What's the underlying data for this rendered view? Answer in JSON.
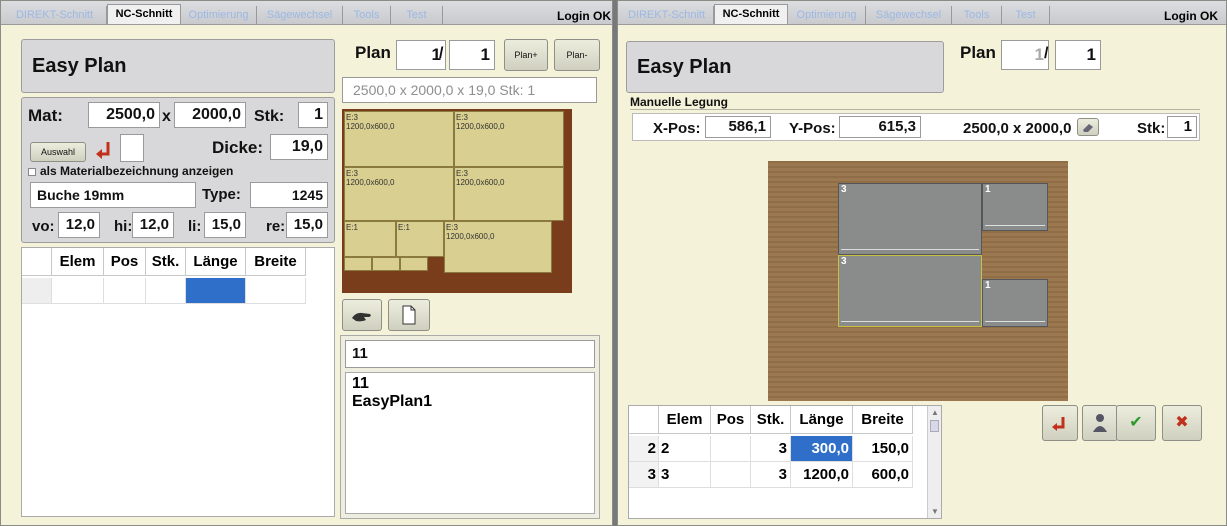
{
  "tabs": [
    "DIREKT-Schnitt",
    "NC-Schnitt",
    "Optimierung",
    "Sägewechsel",
    "Tools",
    "Test"
  ],
  "login": "Login OK",
  "left": {
    "title": "Easy Plan",
    "plan_label": "Plan",
    "plan_current": "1",
    "plan_sep": "/",
    "plan_total": "1",
    "plan_plus": "Plan+",
    "plan_minus": "Plan-",
    "plan_summary": "2500,0 x 2000,0 x 19,0 Stk: 1",
    "mat_label": "Mat:",
    "mat_w": "2500,0",
    "x_label": "x",
    "mat_h": "2000,0",
    "stk_label": "Stk:",
    "stk": "1",
    "auswahl": "Auswahl",
    "dicke_label": "Dicke:",
    "dicke": "19,0",
    "show_matname_label": "als Materialbezeichnung anzeigen",
    "material": "Buche 19mm",
    "type_label": "Type:",
    "type": "1245",
    "vo_label": "vo:",
    "vo": "12,0",
    "hi_label": "hi:",
    "hi": "12,0",
    "li_label": "li:",
    "li": "15,0",
    "re_label": "re:",
    "re": "15,0",
    "columns": [
      "Elem",
      "Pos",
      "Stk.",
      "Länge",
      "Breite"
    ],
    "pieces": [
      {
        "l1": "E:3",
        "l2": "1200,0x600,0"
      },
      {
        "l1": "E:3",
        "l2": "1200,0x600,0"
      },
      {
        "l1": "E:3",
        "l2": "1200,0x600,0"
      },
      {
        "l1": "E:3",
        "l2": "1200,0x600,0"
      },
      {
        "l1": "E:1",
        "l2": ""
      },
      {
        "l1": "E:1",
        "l2": ""
      },
      {
        "l1": "E:3",
        "l2": "1200,0x600,0"
      }
    ],
    "file_input": "11",
    "file_list": [
      "11",
      "EasyPlan1"
    ]
  },
  "right": {
    "title": "Easy Plan",
    "plan_label": "Plan",
    "plan_current": "1",
    "plan_sep": "/",
    "plan_total": "1",
    "section": "Manuelle Legung",
    "xpos_label": "X-Pos:",
    "xpos": "586,1",
    "ypos_label": "Y-Pos:",
    "ypos": "615,3",
    "dims": "2500,0 x 2000,0",
    "stk_label": "Stk:",
    "stk": "1",
    "piece_labels": [
      "3",
      "1",
      "3",
      "1"
    ],
    "columns": [
      "Elem",
      "Pos",
      "Stk.",
      "Länge",
      "Breite"
    ],
    "rows": [
      {
        "idx": "2",
        "elem": "2",
        "pos": "",
        "stk": "3",
        "laenge": "300,0",
        "breite": "150,0"
      },
      {
        "idx": "3",
        "elem": "3",
        "pos": "",
        "stk": "3",
        "laenge": "1200,0",
        "breite": "600,0"
      }
    ]
  },
  "colors": {
    "panel": "#f4f2d9",
    "board_dark": "#7a3d1c",
    "board_wood": "#9a7549",
    "piece_tan": "#d9cf90",
    "selected_cell": "#2f6fc9"
  }
}
